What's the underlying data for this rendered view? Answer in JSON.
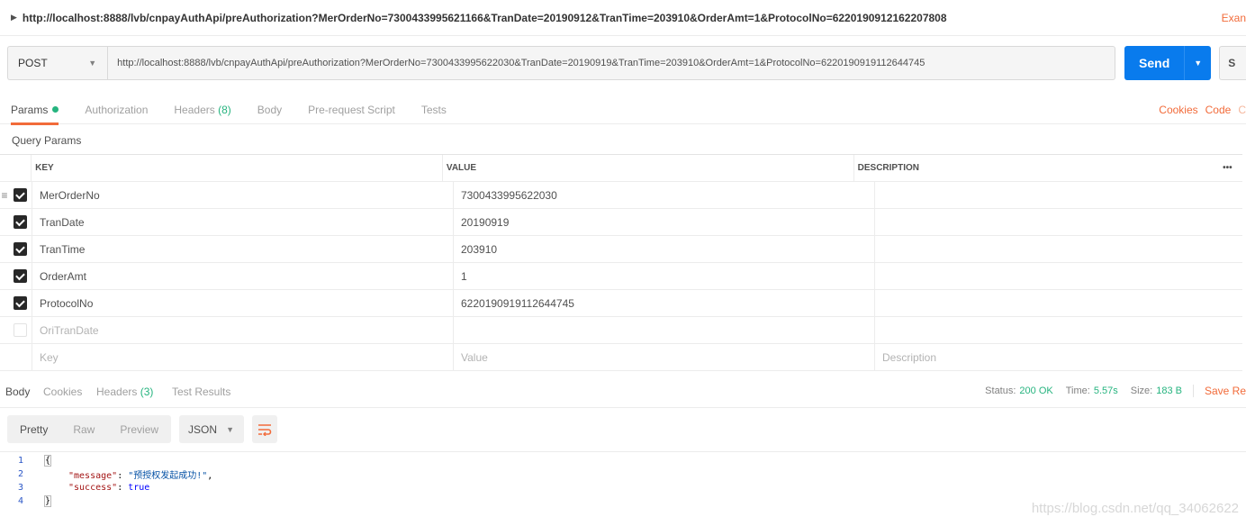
{
  "title_bar": {
    "url": "http://localhost:8888/lvb/cnpayAuthApi/preAuthorization?MerOrderNo=7300433995621166&TranDate=20190912&TranTime=203910&OrderAmt=1&ProtocolNo=6220190912162207808",
    "examples_label": "Exan"
  },
  "request": {
    "method": "POST",
    "url": "http://localhost:8888/lvb/cnpayAuthApi/preAuthorization?MerOrderNo=7300433995622030&TranDate=20190919&TranTime=203910&OrderAmt=1&ProtocolNo=6220190919112644745",
    "send_label": "Send",
    "save_label": "S"
  },
  "request_tabs": [
    {
      "label": "Params",
      "active": true
    },
    {
      "label": "Authorization"
    },
    {
      "label": "Headers",
      "count": "(8)"
    },
    {
      "label": "Body"
    },
    {
      "label": "Pre-request Script"
    },
    {
      "label": "Tests"
    }
  ],
  "request_links": {
    "cookies": "Cookies",
    "code": "Code",
    "comments": "C"
  },
  "query_params": {
    "heading": "Query Params",
    "columns": {
      "key": "KEY",
      "value": "VALUE",
      "description": "DESCRIPTION",
      "more": "•••"
    },
    "rows": [
      {
        "key": "MerOrderNo",
        "value": "7300433995622030",
        "description": ""
      },
      {
        "key": "TranDate",
        "value": "20190919",
        "description": ""
      },
      {
        "key": "TranTime",
        "value": "203910",
        "description": ""
      },
      {
        "key": "OrderAmt",
        "value": "1",
        "description": ""
      },
      {
        "key": "ProtocolNo",
        "value": "6220190919112644745",
        "description": ""
      },
      {
        "key": "OriTranDate",
        "value": "",
        "description": ""
      }
    ],
    "new_row": {
      "key_placeholder": "Key",
      "value_placeholder": "Value",
      "description_placeholder": "Description"
    }
  },
  "response_tabs": [
    {
      "label": "Body"
    },
    {
      "label": "Cookies"
    },
    {
      "label": "Headers",
      "count": "(3)"
    },
    {
      "label": "Test Results"
    }
  ],
  "response_status": {
    "status_label": "Status:",
    "status_value": "200 OK",
    "time_label": "Time:",
    "time_value": "5.57s",
    "size_label": "Size:",
    "size_value": "183 B",
    "save_response": "Save Re"
  },
  "viewer": {
    "modes": [
      "Pretty",
      "Raw",
      "Preview"
    ],
    "format": "JSON"
  },
  "response_body": {
    "line_numbers": [
      "1",
      "2",
      "3",
      "4"
    ],
    "open_brace": "{",
    "message_key": "\"message\"",
    "message_value": "\"预授权发起成功!\"",
    "success_key": "\"success\"",
    "success_value": "true",
    "close_brace": "}"
  },
  "watermark": "https://blog.csdn.net/qq_34062622",
  "colors": {
    "accent_orange": "#f26b3a",
    "send_blue": "#097bed",
    "status_green": "#26b47f"
  }
}
